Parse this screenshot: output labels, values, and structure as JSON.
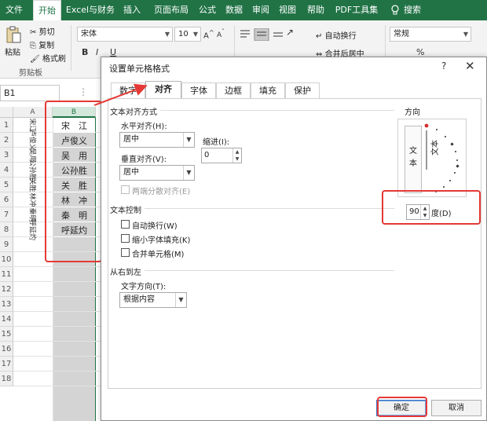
{
  "ribbon": {
    "tabs": [
      "文件",
      "开始",
      "Excel与财务",
      "插入",
      "页面布局",
      "公式",
      "数据",
      "审阅",
      "视图",
      "帮助",
      "PDF工具集",
      "搜索"
    ],
    "active_tab": "开始",
    "search_icon": "lightbulb-icon",
    "accent_color": "#217346",
    "clipboard": {
      "paste": "粘贴",
      "cut": "剪切",
      "copy": "复制",
      "format_painter": "格式刷",
      "group_label": "剪贴板"
    },
    "font": {
      "name": "宋体",
      "size": "10",
      "bold": "B",
      "italic": "I",
      "underline": "U"
    },
    "alignment": {
      "wrap_text": "自动换行",
      "merge_center": "合并后居中"
    },
    "number": {
      "format": "常规",
      "percent": "%"
    }
  },
  "formula_bar": {
    "name_box": "B1",
    "dots": "⋮"
  },
  "grid": {
    "columns": [
      "A",
      "B"
    ],
    "rows": [
      "1",
      "2",
      "3",
      "4",
      "5",
      "6",
      "7",
      "8",
      "9",
      "10",
      "11",
      "12",
      "13",
      "14",
      "15",
      "16",
      "17",
      "18"
    ],
    "col_a": [
      "宋江",
      "卢俊义",
      "吴用",
      "公孙胜",
      "关胜",
      "林冲",
      "秦明",
      "呼延灼"
    ],
    "col_b": [
      "宋　江",
      "卢俊义",
      "吴　用",
      "公孙胜",
      "关　胜",
      "林　冲",
      "秦　明",
      "呼延灼"
    ]
  },
  "dialog": {
    "title": "设置单元格格式",
    "help": "?",
    "close": "✕",
    "tabs": [
      "数字",
      "对齐",
      "字体",
      "边框",
      "填充",
      "保护"
    ],
    "active_tab": "对齐",
    "text_alignment": {
      "group": "文本对齐方式",
      "horizontal_label": "水平对齐(H):",
      "horizontal_value": "居中",
      "indent_label": "缩进(I):",
      "indent_value": "0",
      "vertical_label": "垂直对齐(V):",
      "vertical_value": "居中",
      "justify_distributed": "两端分散对齐(E)"
    },
    "text_control": {
      "group": "文本控制",
      "wrap": "自动换行(W)",
      "shrink": "缩小字体填充(K)",
      "merge": "合并单元格(M)"
    },
    "rtl": {
      "group": "从右到左",
      "direction_label": "文字方向(T):",
      "direction_value": "根据内容"
    },
    "orientation": {
      "group": "方向",
      "vertical_text": "文\n本",
      "dial_text": "文本",
      "degrees_value": "90",
      "degrees_label": "度(D)"
    },
    "ok": "确定",
    "cancel": "取消"
  },
  "annotation_color": "#e53935"
}
